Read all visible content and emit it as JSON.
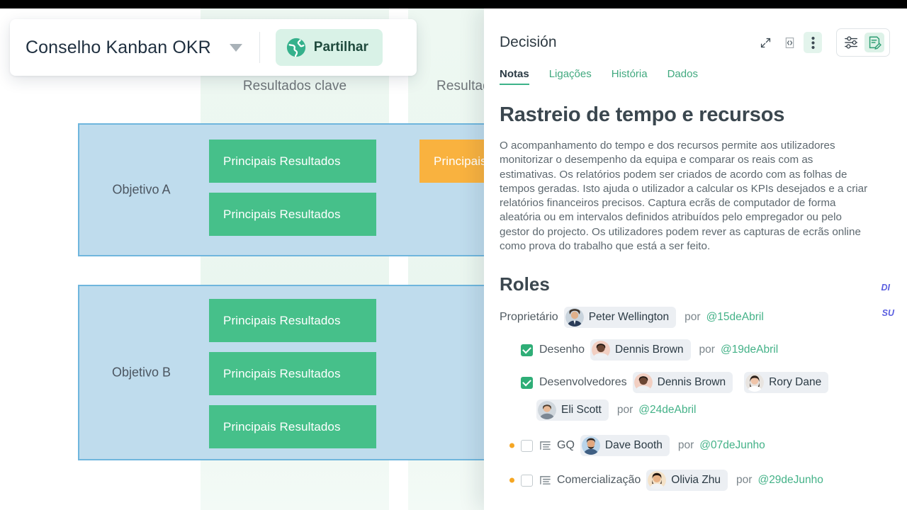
{
  "board": {
    "title": "Conselho Kanban OKR",
    "share_label": "Partilhar",
    "globe_icon": "globe-icon",
    "caret_icon": "chevron-down-icon",
    "columns": [
      {
        "label": "Resultados clave"
      },
      {
        "label": "Resultados clave"
      }
    ],
    "objectives": [
      {
        "label": "Objetivo A",
        "cards": [
          {
            "label": "Principais Resultados",
            "color": "#46c08a"
          },
          {
            "label": "Principais Resultados",
            "color": "#46c08a"
          },
          {
            "label": "Principais Resultados",
            "color": "#f9b23f"
          }
        ]
      },
      {
        "label": "Objetivo B",
        "cards": [
          {
            "label": "Principais Resultados",
            "color": "#46c08a"
          },
          {
            "label": "Principais Resultados",
            "color": "#46c08a"
          },
          {
            "label": "Principais Resultados",
            "color": "#46c08a"
          }
        ]
      }
    ],
    "colors": {
      "objective_fill": "#bfdced",
      "objective_border": "#6fb6dd",
      "column_band": "#eef8f2",
      "card_green": "#46c08a",
      "card_orange": "#f9b23f",
      "share_bg": "#d9f2e7"
    }
  },
  "panel": {
    "title": "Decisión",
    "icons": {
      "expand": "expand-arrows-icon",
      "code": "code-brackets-icon",
      "more": "more-vertical-icon",
      "settings": "sliders-icon",
      "edit": "edit-note-icon"
    },
    "tabs": [
      {
        "label": "Notas",
        "active": true
      },
      {
        "label": "Ligações",
        "active": false
      },
      {
        "label": "História",
        "active": false
      },
      {
        "label": "Dados",
        "active": false
      }
    ],
    "doc": {
      "heading": "Rastreio de tempo e recursos",
      "paragraph": "O acompanhamento do tempo e dos recursos permite aos utilizadores monitorizar o desempenho da equipa e comparar os reais com as estimativas. Os relatórios podem ser criados de acordo com as folhas de tempos geradas. Isto ajuda o utilizador a calcular os KPIs desejados e a criar relatórios financeiros precisos. Captura ecrãs de computador de forma aleatória ou em intervalos definidos atribuídos pelo empregador ou pelo gestor do projecto. Os utilizadores podem rever as capturas de ecrãs online como prova do trabalho que está a ser feito."
    },
    "roles": {
      "title": "Roles",
      "note_di": "DI",
      "note_su": "SU",
      "by_label": "por",
      "rows": [
        {
          "label": "Proprietário",
          "checkbox": "none",
          "bullet": false,
          "list_icon": false,
          "people": [
            {
              "name": "Peter Wellington"
            }
          ],
          "date": "@15deAbril"
        },
        {
          "label": "Desenho",
          "checkbox": "checked",
          "bullet": false,
          "list_icon": false,
          "people": [
            {
              "name": "Dennis Brown"
            }
          ],
          "date": "@19deAbril"
        },
        {
          "label": "Desenvolvedores",
          "checkbox": "checked",
          "bullet": false,
          "list_icon": false,
          "people": [
            {
              "name": "Dennis Brown"
            },
            {
              "name": "Rory Dane"
            }
          ],
          "date": ""
        },
        {
          "label": "",
          "checkbox": "none",
          "bullet": false,
          "list_icon": false,
          "people": [
            {
              "name": "Eli Scott"
            }
          ],
          "date": "@24deAbril"
        },
        {
          "label": "GQ",
          "checkbox": "unchecked",
          "bullet": true,
          "list_icon": true,
          "people": [
            {
              "name": "Dave Booth"
            }
          ],
          "date": "@07deJunho"
        },
        {
          "label": "Comercialização",
          "checkbox": "unchecked",
          "bullet": true,
          "list_icon": true,
          "people": [
            {
              "name": "Olivia Zhu"
            }
          ],
          "date": "@29deJunho"
        }
      ]
    },
    "colors": {
      "accent_green": "#3db389",
      "link_green": "#44b288",
      "note_blue": "#5b5fe0",
      "bullet_orange": "#f5a623"
    }
  }
}
